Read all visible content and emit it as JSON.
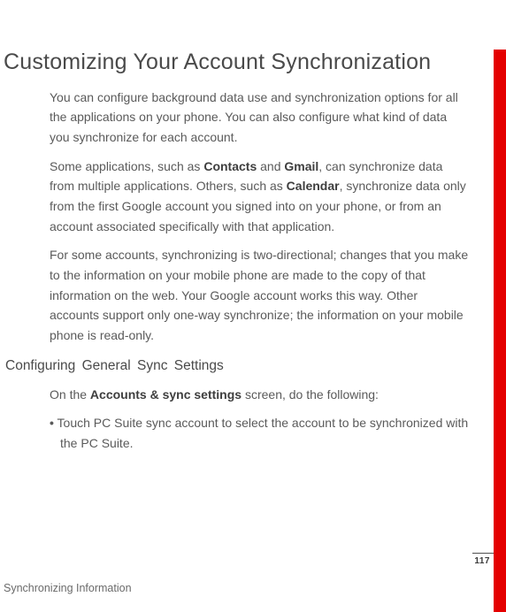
{
  "title": "Customizing Your Account Synchronization",
  "paragraphs": {
    "p1": "You can configure background data use and synchronization options for all the applications on your phone. You can also configure what kind of data you synchronize for each account.",
    "p2_pre": "Some applications, such as ",
    "p2_b1": "Contacts",
    "p2_mid1": " and ",
    "p2_b2": "Gmail",
    "p2_mid2": ", can synchronize data from multiple applications. Others, such as ",
    "p2_b3": "Calendar",
    "p2_post": ", synchronize data only from the first Google account you signed into on your phone, or from an account associated specifically with that application.",
    "p3": "For some accounts, synchronizing is two-directional; changes that you make to the information on your mobile phone are made to the copy of that information on the web. Your Google account works this way. Other accounts support only one-way synchronize; the information on your mobile phone is read-only."
  },
  "subheading": "Configuring General Sync Settings",
  "instruction": {
    "pre": "On the ",
    "bold": "Accounts & sync settings",
    "post": " screen, do the following:"
  },
  "bullet": {
    "dot": "•",
    "pre": " Touch ",
    "bold": "PC Suite sync account",
    "post": " to select the account to be synchronized with the PC Suite."
  },
  "footer": "Synchronizing Information",
  "page_number": "117"
}
